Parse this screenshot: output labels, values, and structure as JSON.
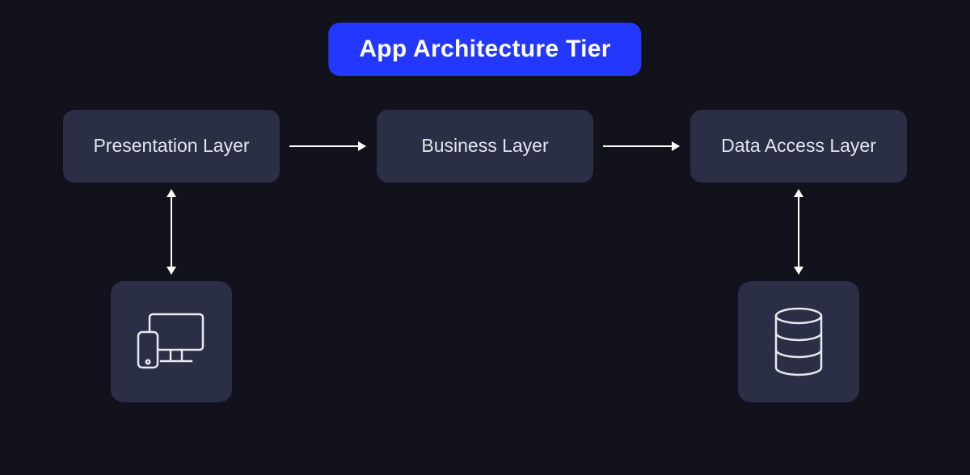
{
  "title": "App Architecture Tier",
  "layers": {
    "presentation": "Presentation Layer",
    "business": "Business Layer",
    "data": "Data Access Layer"
  },
  "icons": {
    "client": "devices-icon",
    "database": "database-icon"
  },
  "colors": {
    "background": "#12121d",
    "box": "#2a2f45",
    "accent": "#2337ff",
    "text": "#e3e5ef",
    "arrow": "#ffffff"
  },
  "connections": [
    {
      "from": "presentation",
      "to": "business",
      "type": "right-arrow"
    },
    {
      "from": "business",
      "to": "data",
      "type": "right-arrow"
    },
    {
      "from": "presentation",
      "to": "client-icon",
      "type": "double-vertical"
    },
    {
      "from": "data",
      "to": "database-icon",
      "type": "double-vertical"
    }
  ]
}
